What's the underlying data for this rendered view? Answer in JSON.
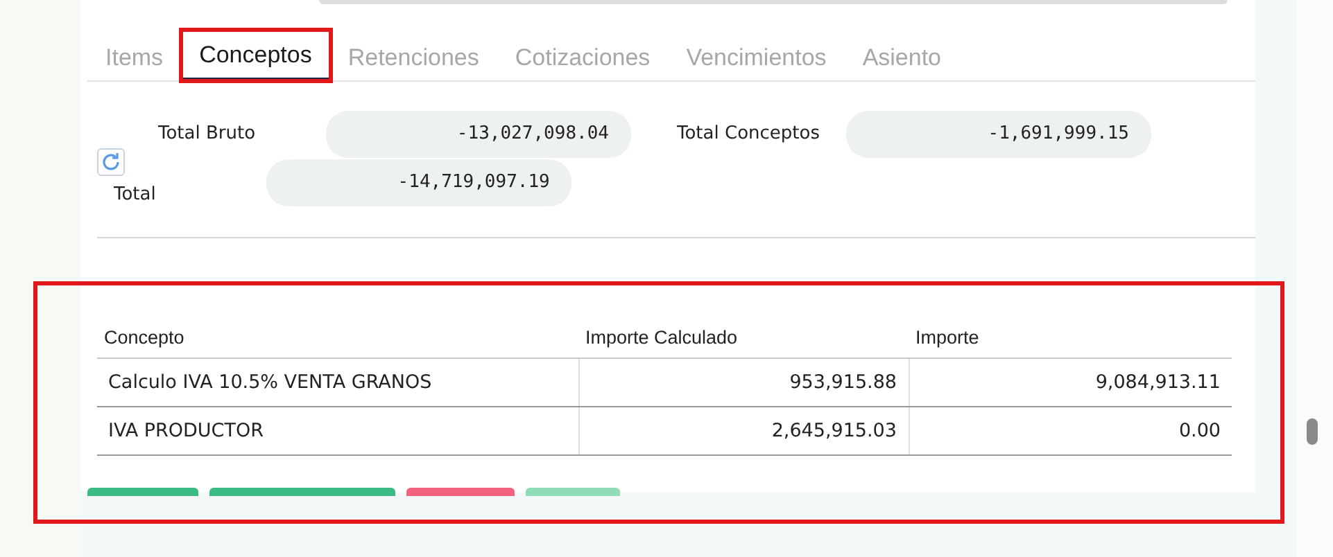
{
  "tabs": [
    {
      "label": "Items",
      "selected": false,
      "highlighted": false
    },
    {
      "label": "Conceptos",
      "selected": true,
      "highlighted": true
    },
    {
      "label": "Retenciones",
      "selected": false,
      "highlighted": false
    },
    {
      "label": "Cotizaciones",
      "selected": false,
      "highlighted": false
    },
    {
      "label": "Vencimientos",
      "selected": false,
      "highlighted": false
    },
    {
      "label": "Asiento",
      "selected": false,
      "highlighted": false
    }
  ],
  "totals": {
    "total_bruto": {
      "label": "Total Bruto",
      "value": "-13,027,098.04"
    },
    "total_conceptos": {
      "label": "Total Conceptos",
      "value": "-1,691,999.15"
    },
    "total": {
      "label": "Total",
      "value": "-14,719,097.19"
    }
  },
  "table": {
    "highlighted": true,
    "columns": [
      "Concepto",
      "Importe Calculado",
      "Importe"
    ],
    "rows": [
      {
        "cells": [
          "Calculo IVA 10.5% VENTA GRANOS",
          "953,915.88",
          "9,084,913.11"
        ]
      },
      {
        "cells": [
          "IVA PRODUCTOR",
          "2,645,915.03",
          "0.00"
        ]
      }
    ]
  },
  "buttons": [
    {
      "color": "#3dbb85"
    },
    {
      "color": "#3dbb85"
    },
    {
      "color": "#f0627f"
    },
    {
      "color": "#8fdcb6"
    }
  ]
}
